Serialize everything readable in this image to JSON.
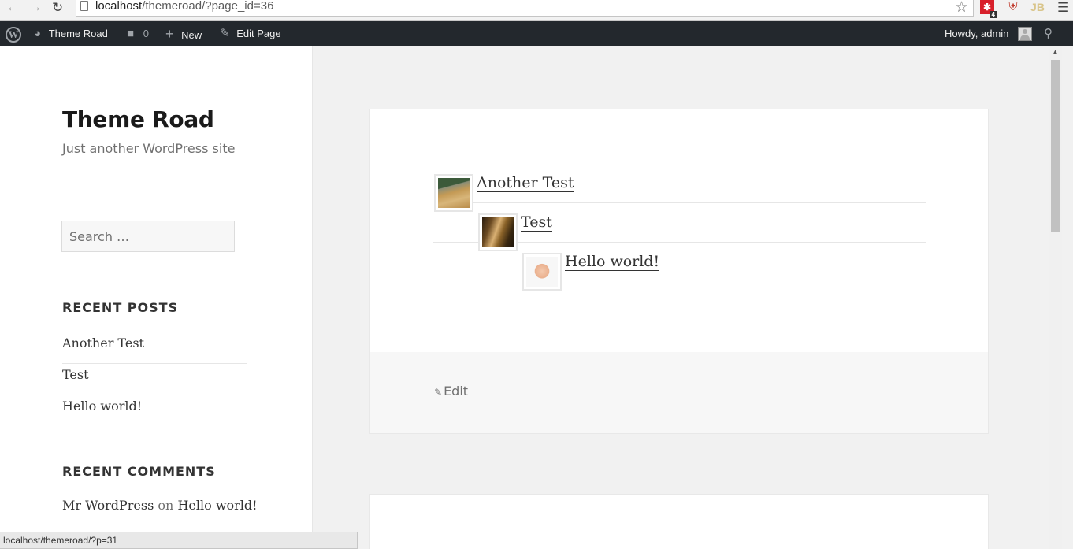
{
  "browser": {
    "url_host": "localhost",
    "url_path": "/themeroad/?page_id=36",
    "ext_badge": "4",
    "ext_jb": "JB"
  },
  "adminbar": {
    "site_name": "Theme Road",
    "comments_count": "0",
    "new_label": "New",
    "edit_page_label": "Edit Page",
    "howdy": "Howdy, admin"
  },
  "sidebar": {
    "site_title": "Theme Road",
    "tagline": "Just another WordPress site",
    "search_placeholder": "Search …",
    "recent_posts_title": "RECENT POSTS",
    "recent_posts": [
      "Another Test",
      "Test",
      "Hello world!"
    ],
    "recent_comments_title": "RECENT COMMENTS",
    "comment_author": "Mr WordPress",
    "comment_on": "on",
    "comment_post": "Hello world!"
  },
  "content": {
    "tree": [
      {
        "title": "Another Test",
        "level": 0
      },
      {
        "title": "Test",
        "level": 1
      },
      {
        "title": "Hello world!",
        "level": 2
      }
    ],
    "edit_label": "Edit"
  },
  "status_bar": {
    "text": "localhost/themeroad/?p=31"
  }
}
